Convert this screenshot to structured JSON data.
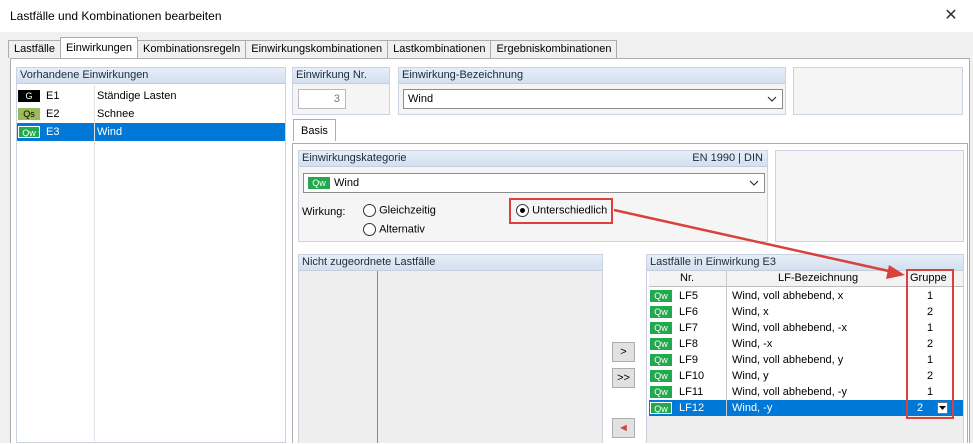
{
  "window": {
    "title": "Lastfälle und Kombinationen bearbeiten",
    "close_glyph": "✕"
  },
  "tabs": [
    "Lastfälle",
    "Einwirkungen",
    "Kombinationsregeln",
    "Einwirkungskombinationen",
    "Lastkombinationen",
    "Ergebniskombinationen"
  ],
  "actions_list": {
    "header": "Vorhandene Einwirkungen",
    "items": [
      {
        "badge": "G",
        "id": "E1",
        "name": "Ständige Lasten"
      },
      {
        "badge": "Qs",
        "id": "E2",
        "name": "Schnee"
      },
      {
        "badge": "Qw",
        "id": "E3",
        "name": "Wind"
      }
    ]
  },
  "action_no": {
    "label": "Einwirkung Nr.",
    "value": "3"
  },
  "action_name": {
    "label": "Einwirkung-Bezeichnung",
    "value": "Wind"
  },
  "basis_tab": "Basis",
  "category": {
    "label": "Einwirkungskategorie",
    "norm": "EN 1990 | DIN",
    "badge": "Qw",
    "value": "Wind"
  },
  "effect": {
    "label": "Wirkung:",
    "options": [
      "Gleichzeitig",
      "Alternativ",
      "Unterschiedlich"
    ],
    "selected": "Unterschiedlich"
  },
  "unassigned": {
    "header": "Nicht zugeordnete Lastfälle"
  },
  "transfer_buttons": [
    ">",
    ">>",
    "◄"
  ],
  "assigned": {
    "header": "Lastfälle in Einwirkung E3",
    "columns": [
      "Nr.",
      "LF-Bezeichnung",
      "Gruppe"
    ],
    "rows": [
      {
        "badge": "Qw",
        "nr": "LF5",
        "name": "Wind, voll abhebend, x",
        "group": "1"
      },
      {
        "badge": "Qw",
        "nr": "LF6",
        "name": "Wind, x",
        "group": "2"
      },
      {
        "badge": "Qw",
        "nr": "LF7",
        "name": "Wind, voll abhebend, -x",
        "group": "1"
      },
      {
        "badge": "Qw",
        "nr": "LF8",
        "name": "Wind, -x",
        "group": "2"
      },
      {
        "badge": "Qw",
        "nr": "LF9",
        "name": "Wind, voll abhebend, y",
        "group": "1"
      },
      {
        "badge": "Qw",
        "nr": "LF10",
        "name": "Wind, y",
        "group": "2"
      },
      {
        "badge": "Qw",
        "nr": "LF11",
        "name": "Wind, voll abhebend, -y",
        "group": "1"
      },
      {
        "badge": "Qw",
        "nr": "LF12",
        "name": "Wind, -y",
        "group": "2"
      }
    ]
  },
  "colors": {
    "selection": "#0078d7",
    "highlight": "#d9413c",
    "qw_badge": "#23a84e"
  }
}
